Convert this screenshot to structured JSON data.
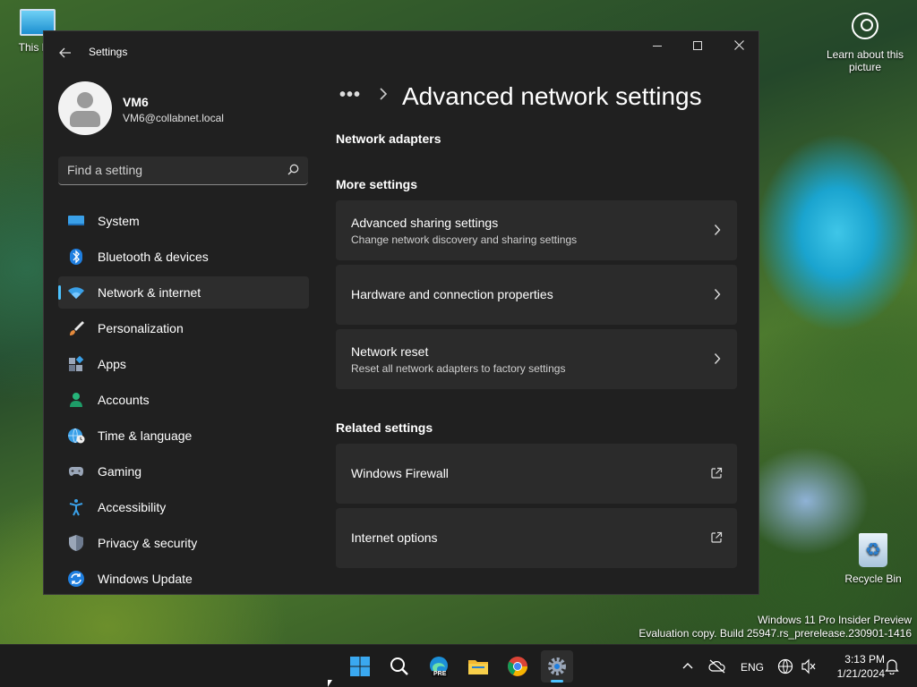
{
  "desktop": {
    "this_pc_label": "This PC",
    "learn_label": "Learn about this picture",
    "recycle_label": "Recycle Bin",
    "watermark_line1": "Windows 11 Pro Insider Preview",
    "watermark_line2": "Evaluation copy. Build 25947.rs_prerelease.230901-1416"
  },
  "window": {
    "title": "Settings"
  },
  "user": {
    "name": "VM6",
    "email": "VM6@collabnet.local"
  },
  "search": {
    "placeholder": "Find a setting"
  },
  "nav": {
    "items": [
      {
        "label": "System",
        "icon": "system-icon"
      },
      {
        "label": "Bluetooth & devices",
        "icon": "bluetooth-icon"
      },
      {
        "label": "Network & internet",
        "icon": "wifi-icon",
        "active": true
      },
      {
        "label": "Personalization",
        "icon": "brush-icon"
      },
      {
        "label": "Apps",
        "icon": "apps-icon"
      },
      {
        "label": "Accounts",
        "icon": "person-icon"
      },
      {
        "label": "Time & language",
        "icon": "globe-clock-icon"
      },
      {
        "label": "Gaming",
        "icon": "gamepad-icon"
      },
      {
        "label": "Accessibility",
        "icon": "accessibility-icon"
      },
      {
        "label": "Privacy & security",
        "icon": "shield-icon"
      },
      {
        "label": "Windows Update",
        "icon": "update-icon"
      }
    ]
  },
  "main": {
    "breadcrumb_more": "•••",
    "page_title": "Advanced network settings",
    "sections": {
      "adapters": "Network adapters",
      "more": "More settings",
      "related": "Related settings"
    },
    "more_cards": [
      {
        "title": "Advanced sharing settings",
        "subtitle": "Change network discovery and sharing settings"
      },
      {
        "title": "Hardware and connection properties",
        "subtitle": ""
      },
      {
        "title": "Network reset",
        "subtitle": "Reset all network adapters to factory settings"
      }
    ],
    "related_cards": [
      {
        "title": "Windows Firewall"
      },
      {
        "title": "Internet options"
      }
    ]
  },
  "taskbar": {
    "language": "ENG",
    "time": "3:13 PM",
    "date": "1/21/2024",
    "edge_badge": "PRE"
  },
  "colors": {
    "accent": "#4cc2ff",
    "window_bg": "#202020",
    "card_bg": "#2b2b2b",
    "taskbar_bg": "#1c1c1c"
  }
}
